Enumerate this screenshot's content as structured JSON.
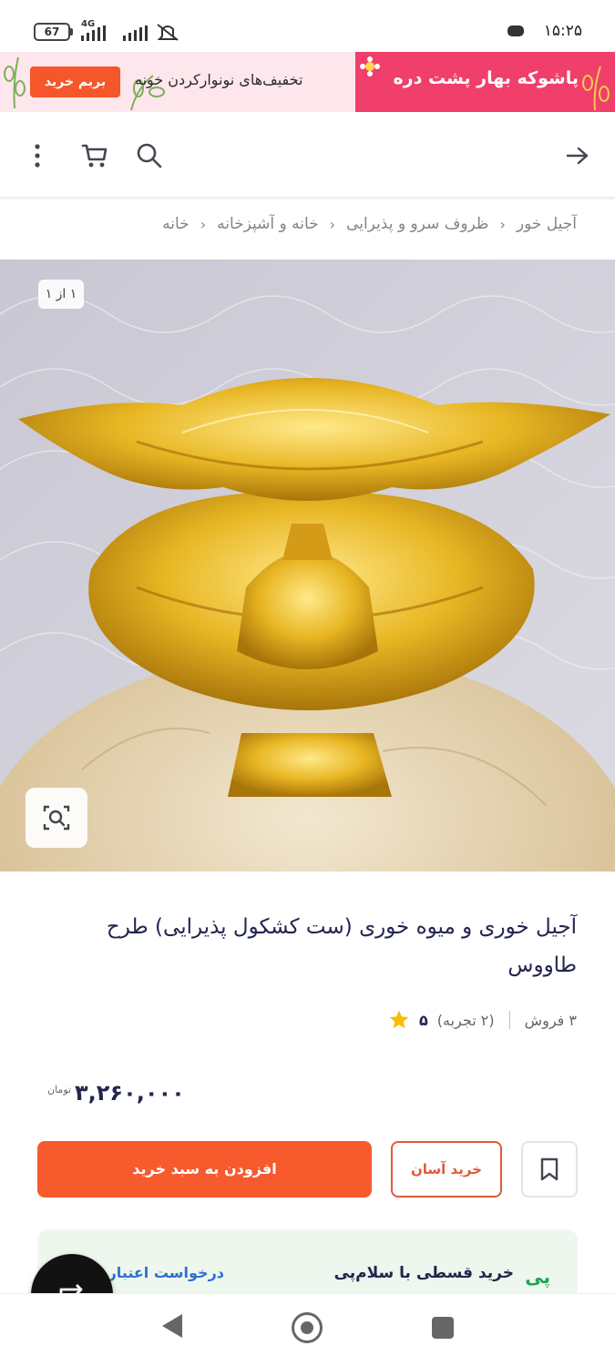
{
  "status_bar": {
    "time": "۱۵:۲۵",
    "battery": "67",
    "network": "4G"
  },
  "promo_banner": {
    "title": "پاشوکه بهار پشت دره",
    "subtitle": "تخفیف‌های نونوارکردن خونه",
    "button": "بریم خرید",
    "colors": {
      "accent": "#ef3f6a",
      "button": "#f5562a",
      "background": "#fde7ec"
    }
  },
  "toolbar": {
    "back_icon": "arrow-right-icon",
    "search_icon": "search-icon",
    "cart_icon": "cart-icon",
    "more_icon": "more-vertical-icon"
  },
  "breadcrumb": [
    "خانه",
    "خانه و آشپزخانه",
    "ظروف سرو و پذیرایی",
    "آجیل خور"
  ],
  "gallery": {
    "counter": "۱ از ۱",
    "zoom_icon": "image-search-icon"
  },
  "product": {
    "title": "آجیل خوری و میوه خوری (ست کشکول پذیرایی) طرح طاووس",
    "rating": "۵",
    "reviews": "(۲ تجربه)",
    "sales": "۳ فروش",
    "price": "۳,۲۶۰,۰۰۰",
    "currency": "تومان"
  },
  "actions": {
    "add_to_cart": "افزودن به سبد خرید",
    "easy_buy": "خرید آسان",
    "bookmark_icon": "bookmark-icon"
  },
  "installment": {
    "logo": "پی",
    "text": "خرید قسطی با سلام‌پی",
    "link": "درخواست اعتبار"
  }
}
